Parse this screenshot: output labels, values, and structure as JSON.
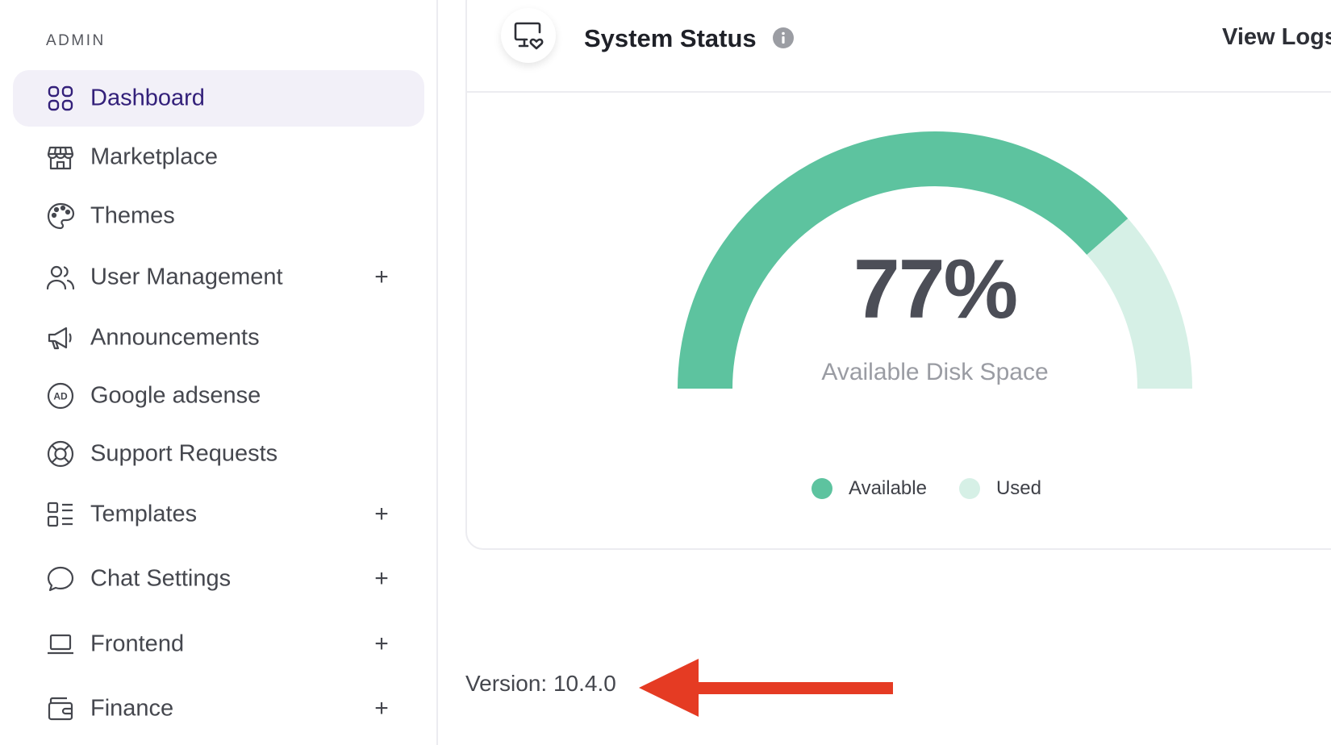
{
  "sidebar": {
    "section_label": "ADMIN",
    "items": [
      {
        "label": "Dashboard",
        "icon": "grid-icon",
        "active": true,
        "expandable": false
      },
      {
        "label": "Marketplace",
        "icon": "store-icon",
        "active": false,
        "expandable": false
      },
      {
        "label": "Themes",
        "icon": "palette-icon",
        "active": false,
        "expandable": false
      },
      {
        "label": "User Management",
        "icon": "users-icon",
        "active": false,
        "expandable": true,
        "expand_symbol": "+"
      },
      {
        "label": "Announcements",
        "icon": "megaphone-icon",
        "active": false,
        "expandable": false
      },
      {
        "label": "Google adsense",
        "icon": "ad-icon",
        "active": false,
        "expandable": false
      },
      {
        "label": "Support Requests",
        "icon": "lifebuoy-icon",
        "active": false,
        "expandable": false
      },
      {
        "label": "Templates",
        "icon": "template-list-icon",
        "active": false,
        "expandable": true,
        "expand_symbol": "+"
      },
      {
        "label": "Chat Settings",
        "icon": "chat-bubble-icon",
        "active": false,
        "expandable": true,
        "expand_symbol": "+"
      },
      {
        "label": "Frontend",
        "icon": "laptop-icon",
        "active": false,
        "expandable": true,
        "expand_symbol": "+"
      },
      {
        "label": "Finance",
        "icon": "wallet-icon",
        "active": false,
        "expandable": true,
        "expand_symbol": "+"
      }
    ]
  },
  "card": {
    "title": "System Status",
    "header_icon": "monitor-heart-icon",
    "info_icon": "info-icon",
    "view_logs_label": "View Logs",
    "gauge": {
      "value_text": "77%",
      "caption": "Available Disk Space",
      "available_fraction": 0.77,
      "colors": {
        "available": "#5dc39f",
        "used": "#d6f0e6"
      }
    },
    "legend": [
      {
        "label": "Available",
        "color": "#5dc39f"
      },
      {
        "label": "Used",
        "color": "#d6f0e6"
      }
    ]
  },
  "footer": {
    "version_text": "Version: 10.4.0",
    "annotation_arrow_color": "#e53b23"
  },
  "colors": {
    "active_bg": "#f2f0f8",
    "active_text": "#33207a",
    "accent_green": "#5dc39f"
  }
}
